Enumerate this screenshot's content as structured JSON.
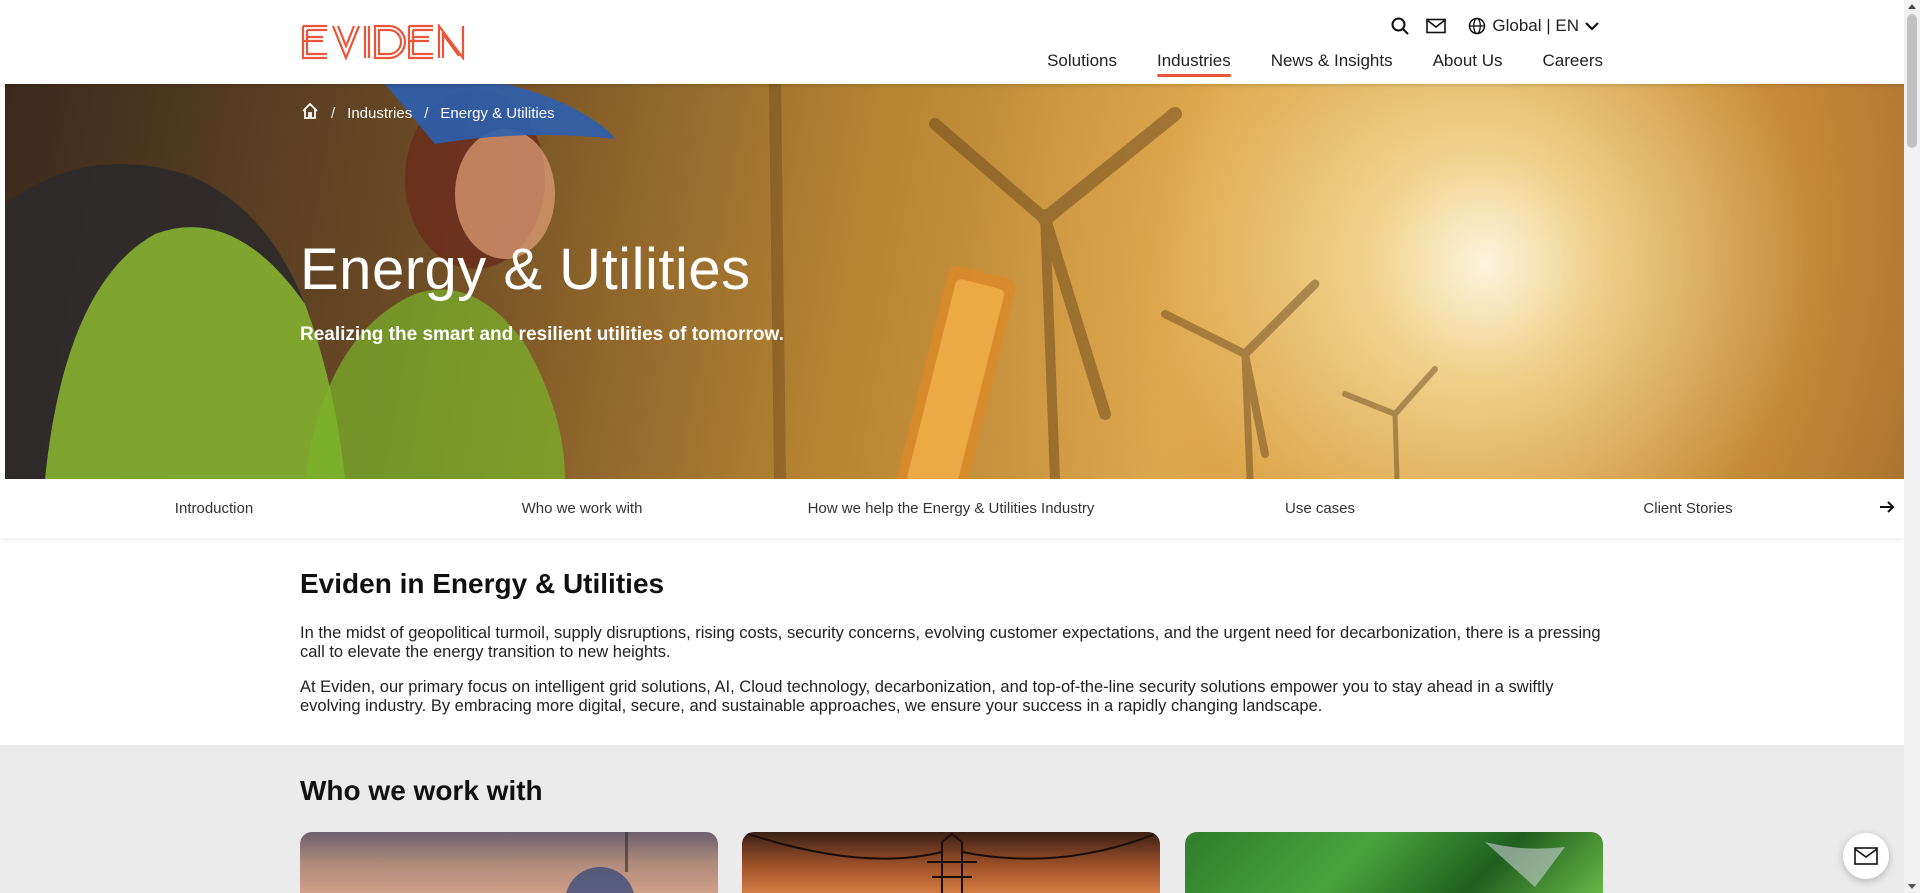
{
  "header": {
    "logo_text": "EVIDEN",
    "search_icon": "search-icon",
    "mail_icon": "mail-icon",
    "lang_label": "Global | EN",
    "nav": [
      "Solutions",
      "Industries",
      "News & Insights",
      "About Us",
      "Careers"
    ],
    "active_nav": "Industries",
    "brand_color": "#e8553a"
  },
  "breadcrumb": {
    "home_icon": "home-icon",
    "items": [
      "Industries",
      "Energy & Utilities"
    ]
  },
  "hero": {
    "title": "Energy & Utilities",
    "subtitle": "Realizing the smart and resilient utilities of tomorrow."
  },
  "anchors": {
    "tabs": [
      "Introduction",
      "Who we work with",
      "How we help the Energy & Utilities Industry",
      "Use cases",
      "Client Stories"
    ],
    "next_icon": "arrow-right-icon"
  },
  "intro": {
    "heading": "Eviden in Energy & Utilities",
    "p1": "In the midst of geopolitical turmoil, supply disruptions, rising costs, security concerns, evolving customer expectations, and the urgent need for decarbonization, there is a pressing call to elevate the energy transition to new heights.",
    "p2": "At Eviden, our primary focus on intelligent grid solutions, AI, Cloud technology, decarbonization, and top-of-the-line security solutions empower you to stay ahead in a swiftly evolving industry. By embracing more digital, secure, and sustainable approaches, we ensure your success in a rapidly changing landscape."
  },
  "who": {
    "heading": "Who we work with"
  },
  "floating": {
    "contact_icon": "mail-icon"
  }
}
